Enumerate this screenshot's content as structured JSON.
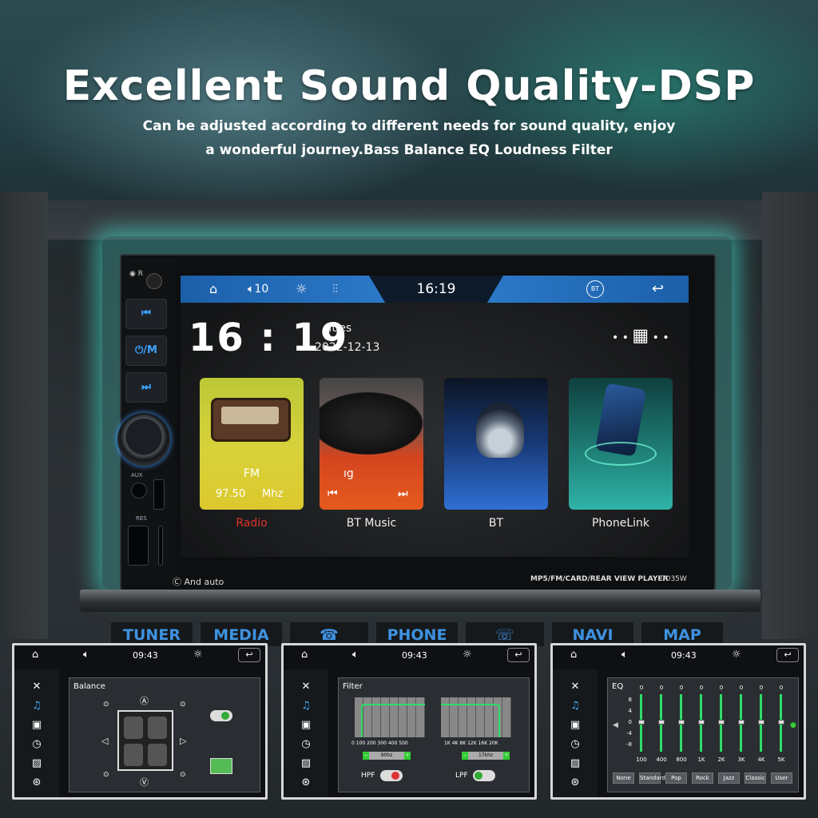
{
  "headline": "Excellent Sound Quality-DSP",
  "subline1": "Can be adjusted according to different needs for sound quality, enjoy",
  "subline2": "a wonderful journey.Bass Balance EQ Loudness Filter",
  "head_unit": {
    "side_buttons": [
      "⏮",
      "⏻/M",
      "⏭"
    ],
    "port_labels": {
      "aux": "AUX",
      "res": "RES"
    },
    "model_text": "MP5/FM/CARD/REAR VIEW PLAYER",
    "model_number": "7035W",
    "brand_text": "And  auto",
    "screen": {
      "volume": "10",
      "time": "16:19",
      "clock_hours": "16",
      "clock_sep": ":",
      "clock_minutes": "19",
      "day": "Tues",
      "date": "2022-12-13",
      "cards": [
        {
          "label": "Radio",
          "line1": "FM",
          "freq": "97.50",
          "unit": "Mhz",
          "label_color": "#e0322b"
        },
        {
          "label": "BT Music",
          "line1": "ıg"
        },
        {
          "label": "BT"
        },
        {
          "label": "PhoneLink"
        }
      ]
    }
  },
  "dash_buttons": [
    "TUNER",
    "MEDIA",
    "PHONE",
    "NAVI",
    "MAP"
  ],
  "mini_screens": {
    "time": "09:43",
    "balance": {
      "title": "Balance"
    },
    "filter": {
      "title": "Filter",
      "hpf_ticks": [
        "0",
        "100",
        "200",
        "300",
        "400",
        "500"
      ],
      "lpf_ticks": [
        "1K",
        "4K",
        "8K",
        "12K",
        "16K",
        "20K"
      ],
      "hpf_value": "90hz",
      "lpf_value": "17khz",
      "hpf_label": "HPF",
      "lpf_label": "LPF"
    },
    "eq": {
      "title": "EQ",
      "y_ticks": [
        "8",
        "4",
        "0",
        "-4",
        "-8"
      ],
      "band_values": [
        "0",
        "0",
        "0",
        "0",
        "0",
        "0",
        "0",
        "0"
      ],
      "band_labels": [
        "100",
        "400",
        "800",
        "1K",
        "2K",
        "3K",
        "4K",
        "5K"
      ],
      "presets": [
        "None",
        "Standard",
        "Pop",
        "Rock",
        "Jazz",
        "Classic",
        "User"
      ]
    }
  }
}
